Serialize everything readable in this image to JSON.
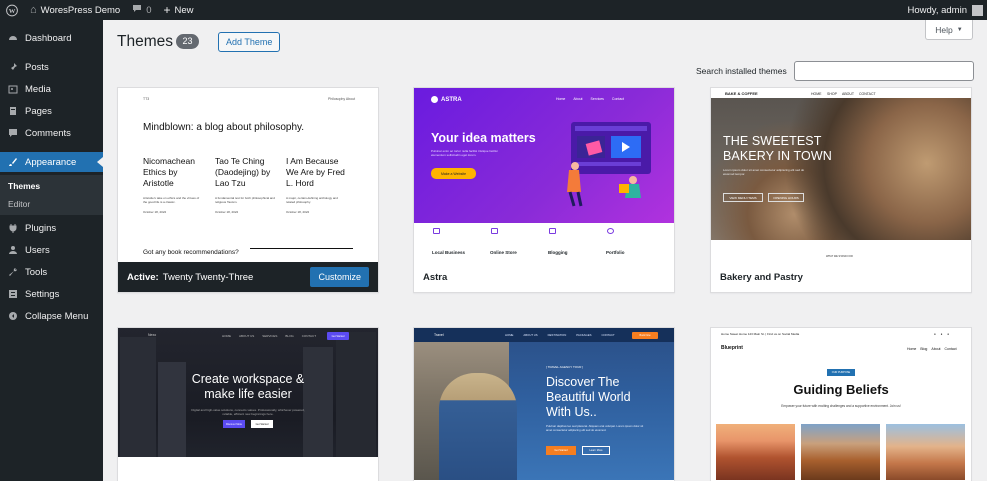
{
  "admin_bar": {
    "site_name": "WoresPress Demo",
    "comments_count": "0",
    "new_label": "New",
    "howdy": "Howdy, admin"
  },
  "menu": {
    "items": [
      {
        "label": "Dashboard",
        "icon": "dashboard-icon"
      },
      {
        "label": "Posts",
        "icon": "pin-icon"
      },
      {
        "label": "Media",
        "icon": "media-icon"
      },
      {
        "label": "Pages",
        "icon": "pages-icon"
      },
      {
        "label": "Comments",
        "icon": "comment-icon"
      },
      {
        "label": "Appearance",
        "icon": "brush-icon"
      },
      {
        "label": "Plugins",
        "icon": "plug-icon"
      },
      {
        "label": "Users",
        "icon": "users-icon"
      },
      {
        "label": "Tools",
        "icon": "wrench-icon"
      },
      {
        "label": "Settings",
        "icon": "settings-icon"
      },
      {
        "label": "Collapse Menu",
        "icon": "collapse-icon"
      }
    ],
    "submenu": [
      "Themes",
      "Editor"
    ]
  },
  "page": {
    "title": "Themes",
    "count": "23",
    "add_theme_label": "Add Theme",
    "help_label": "Help",
    "search_label": "Search installed themes",
    "search_placeholder": ""
  },
  "themes": [
    {
      "name": "Twenty Twenty-Three",
      "active_prefix": "Active:",
      "customize_label": "Customize",
      "preview": {
        "brand": "TT3",
        "nav": "Philosophy  About",
        "title": "Mindblown: a blog about philosophy.",
        "posts": [
          "Nicomachean Ethics by Aristotle",
          "Tao Te Ching (Daodejing) by Lao Tzu",
          "I Am Because We Are by Fred L. Hord"
        ],
        "blurbs": [
          "Aristotle's take on ethics and the virtues of the good life is a classic.",
          "A fundamental text for both philosophical and religious Taoism.",
          "A major, certain-defining anthology and related philosophy."
        ],
        "dates": [
          "October 18, 2022",
          "October 18, 2022",
          "October 18, 2022"
        ],
        "question": "Got any book recommendations?"
      }
    },
    {
      "name": "Astra",
      "preview": {
        "logo": "ASTRA",
        "nav": [
          "Home",
          "About",
          "Services",
          "Contact"
        ],
        "headline": "Your idea matters",
        "subtext": "Pulvinar enim ac tortor nulla facilisi tristique facilisi elementum sollicitudin eget lorem.",
        "cta": "Make a Website",
        "features": [
          "Local Business",
          "Online Store",
          "Blogging",
          "Portfolio"
        ]
      }
    },
    {
      "name": "Bakery and Pastry",
      "preview": {
        "brand": "BAKE & COFFEE",
        "nav": [
          "HOME",
          "SHOP",
          "ABOUT",
          "CONTACT"
        ],
        "headline": "THE SWEETEST BAKERY IN TOWN",
        "subtext": "Lorem ipsum dolor sit amet consectetur adipiscing elit sed do eiusmod tempor.",
        "buttons": [
          "VIEW MENU ITEMS",
          "OPENING HOURS"
        ],
        "label": "WHAT WE STAND FOR"
      }
    },
    {
      "name": "",
      "preview": {
        "brand": "Nexo",
        "nav": [
          "HOME",
          "ABOUT US",
          "SERVICES",
          "BLOG",
          "CONTACT"
        ],
        "top_button": "Get Started",
        "headline": "Create workspace & make life easier",
        "subtext": "Digital and high-value solutions, connects values. Professionally, whichever powered, reliable, efficient new beginnings here.",
        "buttons": [
          "Discover More",
          "Get Started"
        ]
      }
    },
    {
      "name": "",
      "preview": {
        "brand": "Travel",
        "nav": [
          "HOME",
          "ABOUT US",
          "DESTINATION",
          "PACKAGES",
          "CONTACT"
        ],
        "top_button": "Book Now",
        "tag": "[ TRAVEL AGENCY TOUR ]",
        "headline": "Discover The Beautiful World With Us..",
        "subtext": "Pulvinar dapibus leo sed placerat. Aliquam erat volutpat. Lorem ipsum dolor sit amet consectetur adipiscing elit sed do eiusmod.",
        "buttons": [
          "Get Started",
          "Learn More"
        ]
      }
    },
    {
      "name": "",
      "preview": {
        "topline": "Home Sweet Home  123 Main St.  |  Find us on Social Media",
        "social": "● ● ●",
        "brand": "Blueprint",
        "nav": [
          "Home",
          "Blog",
          "About",
          "Contact"
        ],
        "tag": "OUR PURPOSE",
        "headline": "Guiding Beliefs",
        "subtext": "Empower your future with exciting challenges and a supportive environment. Join us!"
      }
    }
  ],
  "colors": {
    "admin_dark": "#1d2327",
    "accent_blue": "#2271b1",
    "astra_purple": "#6a1bdf",
    "page_bg": "#f0f0f1"
  }
}
